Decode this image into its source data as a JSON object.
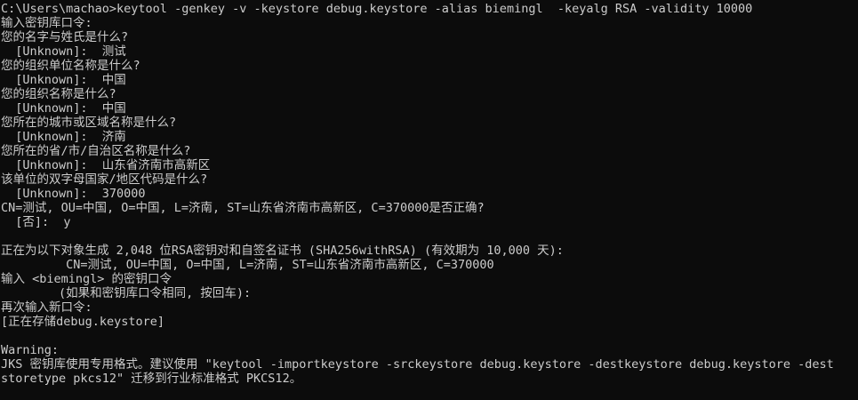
{
  "console": {
    "lines": [
      "C:\\Users\\machao>keytool -genkey -v -keystore debug.keystore -alias biemingl  -keyalg RSA -validity 10000",
      "输入密钥库口令:",
      "您的名字与姓氏是什么?",
      "  [Unknown]:  测试",
      "您的组织单位名称是什么?",
      "  [Unknown]:  中国",
      "您的组织名称是什么?",
      "  [Unknown]:  中国",
      "您所在的城市或区域名称是什么?",
      "  [Unknown]:  济南",
      "您所在的省/市/自治区名称是什么?",
      "  [Unknown]:  山东省济南市高新区",
      "该单位的双字母国家/地区代码是什么?",
      "  [Unknown]:  370000",
      "CN=测试, OU=中国, O=中国, L=济南, ST=山东省济南市高新区, C=370000是否正确?",
      "  [否]:  y",
      "",
      "正在为以下对象生成 2,048 位RSA密钥对和自签名证书 (SHA256withRSA) (有效期为 10,000 天):",
      "         CN=测试, OU=中国, O=中国, L=济南, ST=山东省济南市高新区, C=370000",
      "输入 <biemingl> 的密钥口令",
      "        (如果和密钥库口令相同, 按回车):",
      "再次输入新口令:",
      "[正在存储debug.keystore]",
      "",
      "Warning:",
      "JKS 密钥库使用专用格式。建议使用 \"keytool -importkeystore -srckeystore debug.keystore -destkeystore debug.keystore -dest",
      "storetype pkcs12\" 迁移到行业标准格式 PKCS12。"
    ]
  }
}
